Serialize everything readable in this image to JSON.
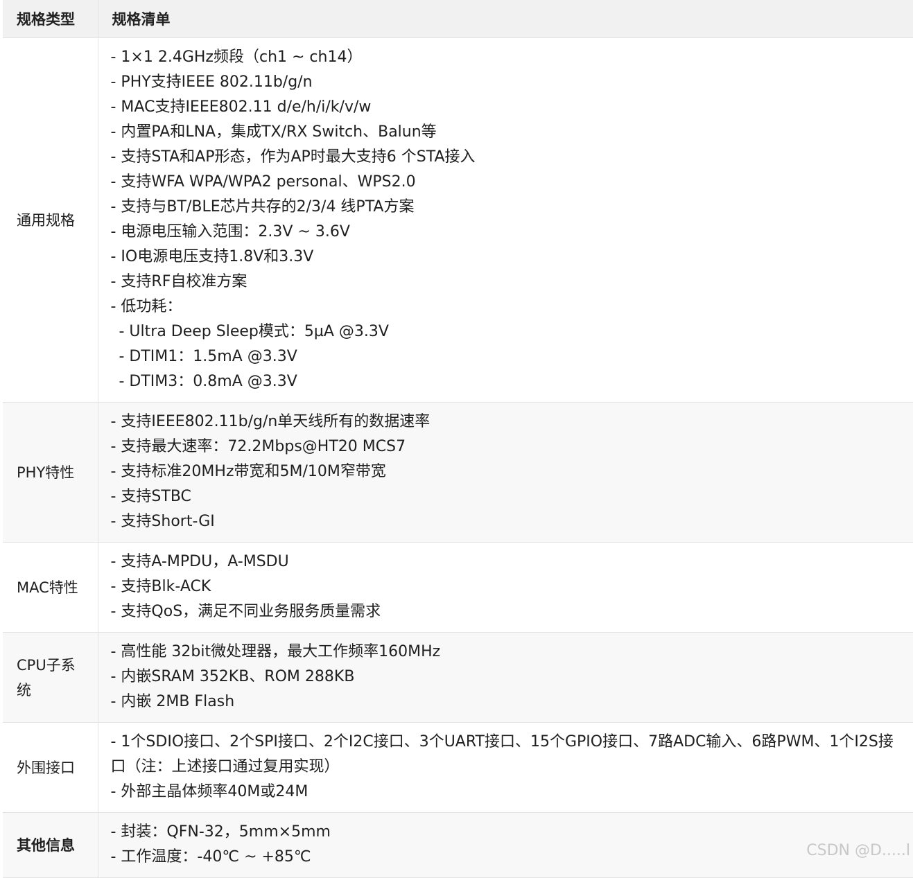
{
  "header": {
    "col1": "规格类型",
    "col2": "规格清单"
  },
  "rows": [
    {
      "category": "通用规格",
      "items": [
        "- 1×1 2.4GHz频段（ch1 ~ ch14）",
        "- PHY支持IEEE 802.11b/g/n",
        "- MAC支持IEEE802.11 d/e/h/i/k/v/w",
        "- 内置PA和LNA，集成TX/RX Switch、Balun等",
        "- 支持STA和AP形态，作为AP时最大支持6 个STA接入",
        "- 支持WFA WPA/WPA2 personal、WPS2.0",
        "- 支持与BT/BLE芯片共存的2/3/4 线PTA方案",
        "- 电源电压输入范围：2.3V ~ 3.6V",
        "- IO电源电压支持1.8V和3.3V",
        "- 支持RF自校准方案",
        "- 低功耗："
      ],
      "subitems": [
        "- Ultra Deep Sleep模式：5µA @3.3V",
        "- DTIM1：1.5mA @3.3V",
        "- DTIM3：0.8mA @3.3V"
      ]
    },
    {
      "category": "PHY特性",
      "items": [
        "- 支持IEEE802.11b/g/n单天线所有的数据速率",
        "- 支持最大速率：72.2Mbps@HT20 MCS7",
        "- 支持标准20MHz带宽和5M/10M窄带宽",
        "- 支持STBC",
        "- 支持Short-GI"
      ]
    },
    {
      "category": "MAC特性",
      "items": [
        "- 支持A-MPDU，A-MSDU",
        "- 支持Blk-ACK",
        "- 支持QoS，满足不同业务服务质量需求"
      ]
    },
    {
      "category": "CPU子系统",
      "items": [
        "- 高性能 32bit微处理器，最大工作频率160MHz",
        "- 内嵌SRAM 352KB、ROM 288KB",
        "- 内嵌 2MB Flash"
      ]
    },
    {
      "category": "外围接口",
      "items": [
        "- 1个SDIO接口、2个SPI接口、2个I2C接口、3个UART接口、15个GPIO接口、7路ADC输入、6路PWM、1个I2S接口（注：上述接口通过复用实现）",
        "- 外部主晶体频率40M或24M"
      ]
    },
    {
      "category": "其他信息",
      "items": [
        "- 封装：QFN-32，5mm×5mm",
        "- 工作温度：-40℃ ~ +85℃"
      ]
    }
  ],
  "watermark": "CSDN @D.....l"
}
